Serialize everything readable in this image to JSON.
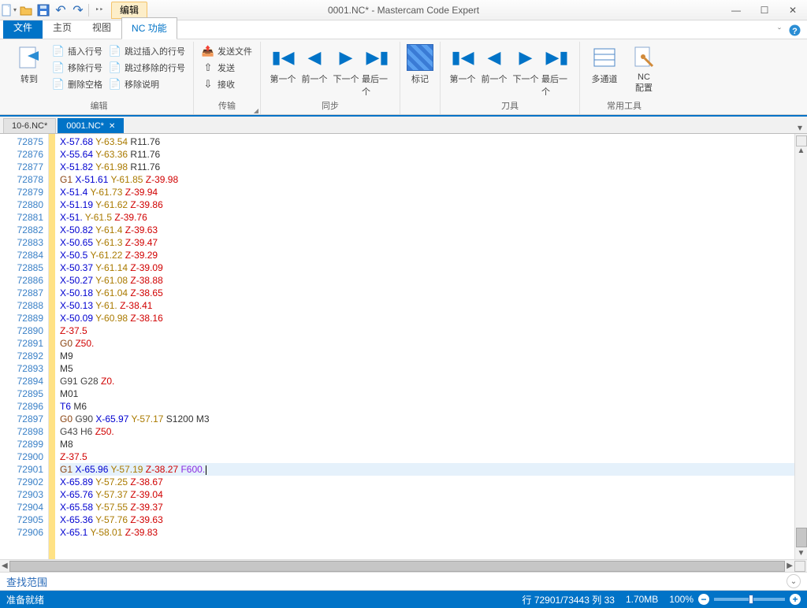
{
  "window": {
    "title": "0001.NC* - Mastercam Code Expert"
  },
  "qa": {
    "edit_tab": "编辑"
  },
  "tabs": {
    "file": "文件",
    "home": "主页",
    "view": "视图",
    "nc": "NC 功能"
  },
  "ribbon": {
    "group1": {
      "label": "编辑",
      "goto": "转到",
      "insert_line": "插入行号",
      "remove_line": "移除行号",
      "remove_blank": "删除空格",
      "skip_inserted": "跳过插入的行号",
      "skip_removed": "跳过移除的行号",
      "remove_comment": "移除说明"
    },
    "group2": {
      "label": "传输",
      "send_file": "发送文件",
      "send": "发送",
      "receive": "接收"
    },
    "group3": {
      "label": "同步",
      "first": "第一个",
      "prev": "前一个",
      "next": "下一个",
      "last": "最后一个"
    },
    "group4": {
      "label": "标记",
      "mark": "标记"
    },
    "group5": {
      "label": "刀具",
      "first": "第一个",
      "prev": "前一个",
      "next": "下一个",
      "last": "最后一个"
    },
    "group6": {
      "label": "常用工具",
      "multi": "多通道",
      "nc1": "NC",
      "nc2": "配置"
    }
  },
  "docs": {
    "t1": "10-6.NC*",
    "t2": "0001.NC*"
  },
  "code_lines": [
    {
      "n": "72875",
      "t": [
        [
          "x",
          "X-57.68"
        ],
        [
          "y",
          " Y-63.54"
        ],
        [
          "r",
          " R11.76"
        ]
      ]
    },
    {
      "n": "72876",
      "t": [
        [
          "x",
          "X-55.64"
        ],
        [
          "y",
          " Y-63.36"
        ],
        [
          "r",
          " R11.76"
        ]
      ]
    },
    {
      "n": "72877",
      "t": [
        [
          "x",
          "X-51.82"
        ],
        [
          "y",
          " Y-61.98"
        ],
        [
          "r",
          " R11.76"
        ]
      ]
    },
    {
      "n": "72878",
      "t": [
        [
          "g",
          "G1"
        ],
        [
          "x",
          " X-51.61"
        ],
        [
          "y",
          " Y-61.85"
        ],
        [
          "z",
          " Z-39.98"
        ]
      ]
    },
    {
      "n": "72879",
      "t": [
        [
          "x",
          "X-51.4"
        ],
        [
          "y",
          " Y-61.73"
        ],
        [
          "z",
          " Z-39.94"
        ]
      ]
    },
    {
      "n": "72880",
      "t": [
        [
          "x",
          "X-51.19"
        ],
        [
          "y",
          " Y-61.62"
        ],
        [
          "z",
          " Z-39.86"
        ]
      ]
    },
    {
      "n": "72881",
      "t": [
        [
          "x",
          "X-51."
        ],
        [
          "y",
          " Y-61.5"
        ],
        [
          "z",
          " Z-39.76"
        ]
      ]
    },
    {
      "n": "72882",
      "t": [
        [
          "x",
          "X-50.82"
        ],
        [
          "y",
          " Y-61.4"
        ],
        [
          "z",
          " Z-39.63"
        ]
      ]
    },
    {
      "n": "72883",
      "t": [
        [
          "x",
          "X-50.65"
        ],
        [
          "y",
          " Y-61.3"
        ],
        [
          "z",
          " Z-39.47"
        ]
      ]
    },
    {
      "n": "72884",
      "t": [
        [
          "x",
          "X-50.5"
        ],
        [
          "y",
          " Y-61.22"
        ],
        [
          "z",
          " Z-39.29"
        ]
      ]
    },
    {
      "n": "72885",
      "t": [
        [
          "x",
          "X-50.37"
        ],
        [
          "y",
          " Y-61.14"
        ],
        [
          "z",
          " Z-39.09"
        ]
      ]
    },
    {
      "n": "72886",
      "t": [
        [
          "x",
          "X-50.27"
        ],
        [
          "y",
          " Y-61.08"
        ],
        [
          "z",
          " Z-38.88"
        ]
      ]
    },
    {
      "n": "72887",
      "t": [
        [
          "x",
          "X-50.18"
        ],
        [
          "y",
          " Y-61.04"
        ],
        [
          "z",
          " Z-38.65"
        ]
      ]
    },
    {
      "n": "72888",
      "t": [
        [
          "x",
          "X-50.13"
        ],
        [
          "y",
          " Y-61."
        ],
        [
          "z",
          " Z-38.41"
        ]
      ]
    },
    {
      "n": "72889",
      "t": [
        [
          "x",
          "X-50.09"
        ],
        [
          "y",
          " Y-60.98"
        ],
        [
          "z",
          " Z-38.16"
        ]
      ]
    },
    {
      "n": "72890",
      "t": [
        [
          "z",
          "Z-37.5"
        ]
      ]
    },
    {
      "n": "72891",
      "t": [
        [
          "g",
          "G0"
        ],
        [
          "z",
          " Z50."
        ]
      ]
    },
    {
      "n": "72892",
      "t": [
        [
          "m",
          "M9"
        ]
      ]
    },
    {
      "n": "72893",
      "t": [
        [
          "m",
          "M5"
        ]
      ]
    },
    {
      "n": "72894",
      "t": [
        [
          "g3",
          "G91 G28"
        ],
        [
          "z",
          " Z0."
        ]
      ]
    },
    {
      "n": "72895",
      "t": [
        [
          "m",
          "M01"
        ]
      ]
    },
    {
      "n": "72896",
      "t": [
        [
          "x",
          "T6"
        ],
        [
          "misc",
          " M6"
        ]
      ]
    },
    {
      "n": "72897",
      "t": [
        [
          "g",
          "G0"
        ],
        [
          "g3",
          " G90"
        ],
        [
          "x",
          " X-65.97"
        ],
        [
          "y",
          " Y-57.17"
        ],
        [
          "misc",
          " S1200 M3"
        ]
      ]
    },
    {
      "n": "72898",
      "t": [
        [
          "g3",
          "G43 H6"
        ],
        [
          "z",
          " Z50."
        ]
      ]
    },
    {
      "n": "72899",
      "t": [
        [
          "m",
          "M8"
        ]
      ]
    },
    {
      "n": "72900",
      "t": [
        [
          "z",
          "Z-37.5"
        ]
      ]
    },
    {
      "n": "72901",
      "current": true,
      "t": [
        [
          "g",
          "G1"
        ],
        [
          "x",
          " X-65.96"
        ],
        [
          "y",
          " Y-57.19"
        ],
        [
          "z",
          " Z-38.27"
        ],
        [
          "f",
          " F600."
        ]
      ]
    },
    {
      "n": "72902",
      "t": [
        [
          "x",
          "X-65.89"
        ],
        [
          "y",
          " Y-57.25"
        ],
        [
          "z",
          " Z-38.67"
        ]
      ]
    },
    {
      "n": "72903",
      "t": [
        [
          "x",
          "X-65.76"
        ],
        [
          "y",
          " Y-57.37"
        ],
        [
          "z",
          " Z-39.04"
        ]
      ]
    },
    {
      "n": "72904",
      "t": [
        [
          "x",
          "X-65.58"
        ],
        [
          "y",
          " Y-57.55"
        ],
        [
          "z",
          " Z-39.37"
        ]
      ]
    },
    {
      "n": "72905",
      "t": [
        [
          "x",
          "X-65.36"
        ],
        [
          "y",
          " Y-57.76"
        ],
        [
          "z",
          " Z-39.63"
        ]
      ]
    },
    {
      "n": "72906",
      "t": [
        [
          "x",
          "X-65.1"
        ],
        [
          "y",
          " Y-58.01"
        ],
        [
          "z",
          " Z-39.83"
        ]
      ]
    }
  ],
  "find": {
    "label": "查找范围"
  },
  "status": {
    "ready": "准备就绪",
    "pos": "行 72901/73443  列 33",
    "size": "1.70MB",
    "zoom": "100%"
  }
}
